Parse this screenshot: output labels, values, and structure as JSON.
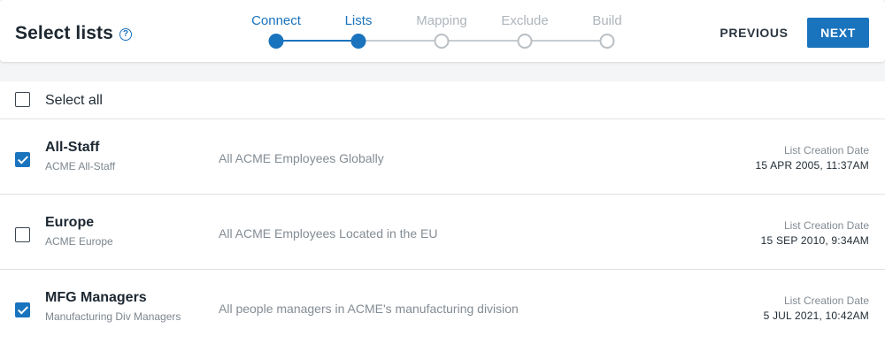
{
  "header": {
    "title": "Select lists",
    "help_icon": "?",
    "previous_label": "PREVIOUS",
    "next_label": "NEXT"
  },
  "stepper": {
    "steps": [
      {
        "label": "Connect",
        "state": "done"
      },
      {
        "label": "Lists",
        "state": "current"
      },
      {
        "label": "Mapping",
        "state": "todo"
      },
      {
        "label": "Exclude",
        "state": "todo"
      },
      {
        "label": "Build",
        "state": "todo"
      }
    ]
  },
  "select_all": {
    "label": "Select all",
    "checked": false
  },
  "lists": [
    {
      "name": "All-Staff",
      "sub": "ACME All-Staff",
      "description": "All ACME Employees Globally",
      "date_label": "List Creation Date",
      "date": "15 APR 2005, 11:37AM",
      "checked": true
    },
    {
      "name": "Europe",
      "sub": "ACME Europe",
      "description": "All ACME Employees Located in the EU",
      "date_label": "List Creation Date",
      "date": "15 SEP 2010, 9:34AM",
      "checked": false
    },
    {
      "name": "MFG Managers",
      "sub": "Manufacturing Div Managers",
      "description": "All people managers in ACME's manufacturing division",
      "date_label": "List Creation Date",
      "date": "5 JUL 2021, 10:42AM",
      "checked": true
    }
  ],
  "colors": {
    "accent": "#1a73bd",
    "inactive": "#aeb5bb",
    "background": "#f3f5f7"
  }
}
